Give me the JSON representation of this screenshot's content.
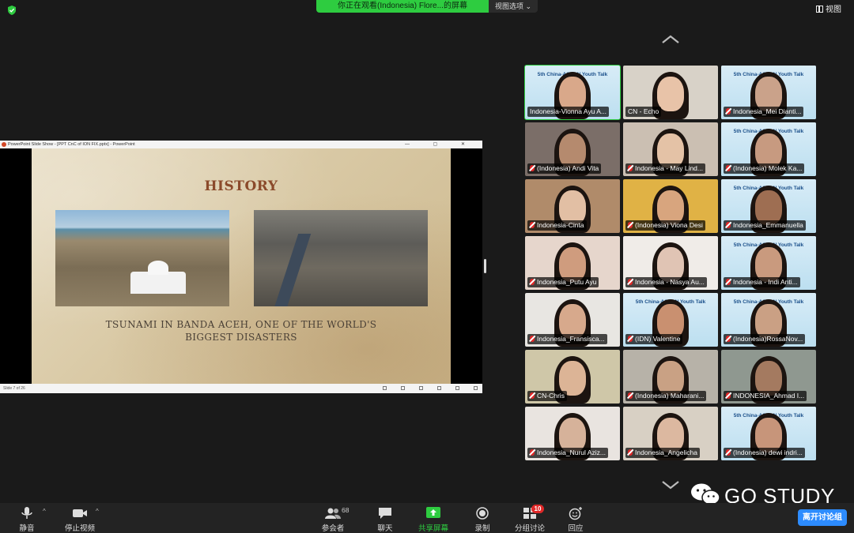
{
  "topbar": {
    "share_banner": "你正在观看(Indonesia) Flore...的屏幕",
    "view_options": "视图选项",
    "view_button": "视图"
  },
  "ppt": {
    "window_title": "PowerPoint Slide Show - [PPT CnC of ION FIX.pptx] - PowerPoint",
    "slide_title": "HISTORY",
    "caption_line1": "TSUNAMI IN BANDA ACEH, ONE OF THE WORLD'S",
    "caption_line2": "BIGGEST DISASTERS",
    "status_text": "Slide 7 of 26"
  },
  "gallery": {
    "tiles": [
      {
        "name": "Indonesia-Vionna Ayu A...",
        "muted": false,
        "active": true,
        "banner": "5th China-ASEAN Youth Talk",
        "skin": "#d9a88a",
        "bg": "#a9cbe0"
      },
      {
        "name": "CN - Echo",
        "muted": false,
        "active": false,
        "banner": "",
        "skin": "#e8c3a8",
        "bg": "#d8d2c8"
      },
      {
        "name": "Indonesia_Mei Dianti...",
        "muted": true,
        "active": false,
        "banner": "5th China-ASEAN Youth Talk",
        "skin": "#caa28a",
        "bg": "#c9e3f1"
      },
      {
        "name": "(Indonesia) Andi Vita",
        "muted": true,
        "active": false,
        "banner": "",
        "skin": "#b58a6e",
        "bg": "#7b6e68"
      },
      {
        "name": "Indonesia - May Lind...",
        "muted": true,
        "active": false,
        "banner": "",
        "skin": "#e4c2a6",
        "bg": "#cbbfb2"
      },
      {
        "name": "(Indonesia) Molek Ka...",
        "muted": true,
        "active": false,
        "banner": "5th China-ASEAN Youth Talk",
        "skin": "#c79a80",
        "bg": "#c9e3f1"
      },
      {
        "name": "Indonesia-Cinta",
        "muted": true,
        "active": false,
        "banner": "",
        "skin": "#e2bfa4",
        "bg": "#b08b6a"
      },
      {
        "name": "(Indonesia) Viona Desi",
        "muted": true,
        "active": false,
        "banner": "",
        "skin": "#d8a57e",
        "bg": "#e0b245"
      },
      {
        "name": "Indonesia_Emmanuella",
        "muted": true,
        "active": false,
        "banner": "5th China-ASEAN Youth Talk",
        "skin": "#9e6e52",
        "bg": "#c9e3f1"
      },
      {
        "name": "Indonesia_Putu Ayu",
        "muted": true,
        "active": false,
        "banner": "",
        "skin": "#cf9c7e",
        "bg": "#e6d6cc"
      },
      {
        "name": "Indonesia - Nasya Au...",
        "muted": true,
        "active": false,
        "banner": "",
        "skin": "#e0c4b4",
        "bg": "#f0ece8"
      },
      {
        "name": "Indonesia - Indi Anti...",
        "muted": true,
        "active": false,
        "banner": "5th China-ASEAN Youth Talk",
        "skin": "#c99a7e",
        "bg": "#c9e3f1"
      },
      {
        "name": "Indonesia_Fransisca...",
        "muted": true,
        "active": false,
        "banner": "",
        "skin": "#d7a98c",
        "bg": "#e8e6e2"
      },
      {
        "name": "(IDN) Valentine",
        "muted": true,
        "active": false,
        "banner": "5th China-ASEAN Youth Talk",
        "skin": "#c99070",
        "bg": "#c9e3f1"
      },
      {
        "name": "(Indonesia)RossaNov...",
        "muted": true,
        "active": false,
        "banner": "5th China-ASEAN Youth Talk",
        "skin": "#caa084",
        "bg": "#c9e3f1"
      },
      {
        "name": "CN-Chris",
        "muted": true,
        "active": false,
        "banner": "",
        "skin": "#dcb496",
        "bg": "#cfc7a8"
      },
      {
        "name": "(Indonesia) Maharani...",
        "muted": true,
        "active": false,
        "banner": "",
        "skin": "#c9a184",
        "bg": "#b7b2a8"
      },
      {
        "name": "INDONESIA_Ahmad I...",
        "muted": true,
        "active": false,
        "banner": "",
        "skin": "#a47a60",
        "bg": "#8f9890"
      },
      {
        "name": "Indonesia_Nurul Aziz...",
        "muted": true,
        "active": false,
        "banner": "",
        "skin": "#d6b29a",
        "bg": "#e9e4e0"
      },
      {
        "name": "Indonesia_Angelicha",
        "muted": true,
        "active": false,
        "banner": "",
        "skin": "#dcb8a0",
        "bg": "#d8d0c4"
      },
      {
        "name": "(Indonesia) dewi indri...",
        "muted": true,
        "active": false,
        "banner": "5th China-ASEAN Youth Talk",
        "skin": "#c7957a",
        "bg": "#c9e3f1"
      }
    ]
  },
  "watermark": {
    "text": "GO STUDY"
  },
  "toolbar": {
    "mute_label": "静音",
    "stop_video_label": "停止视频",
    "participants_label": "参会者",
    "participants_count": "68",
    "chat_label": "聊天",
    "share_label": "共享屏幕",
    "record_label": "录制",
    "breakout_label": "分组讨论",
    "breakout_badge": "10",
    "reactions_label": "回应",
    "leave_label": "离开讨论组"
  },
  "colors": {
    "accent_green": "#2ecc40",
    "leave_blue": "#2d8cff",
    "badge_red": "#e02828"
  }
}
